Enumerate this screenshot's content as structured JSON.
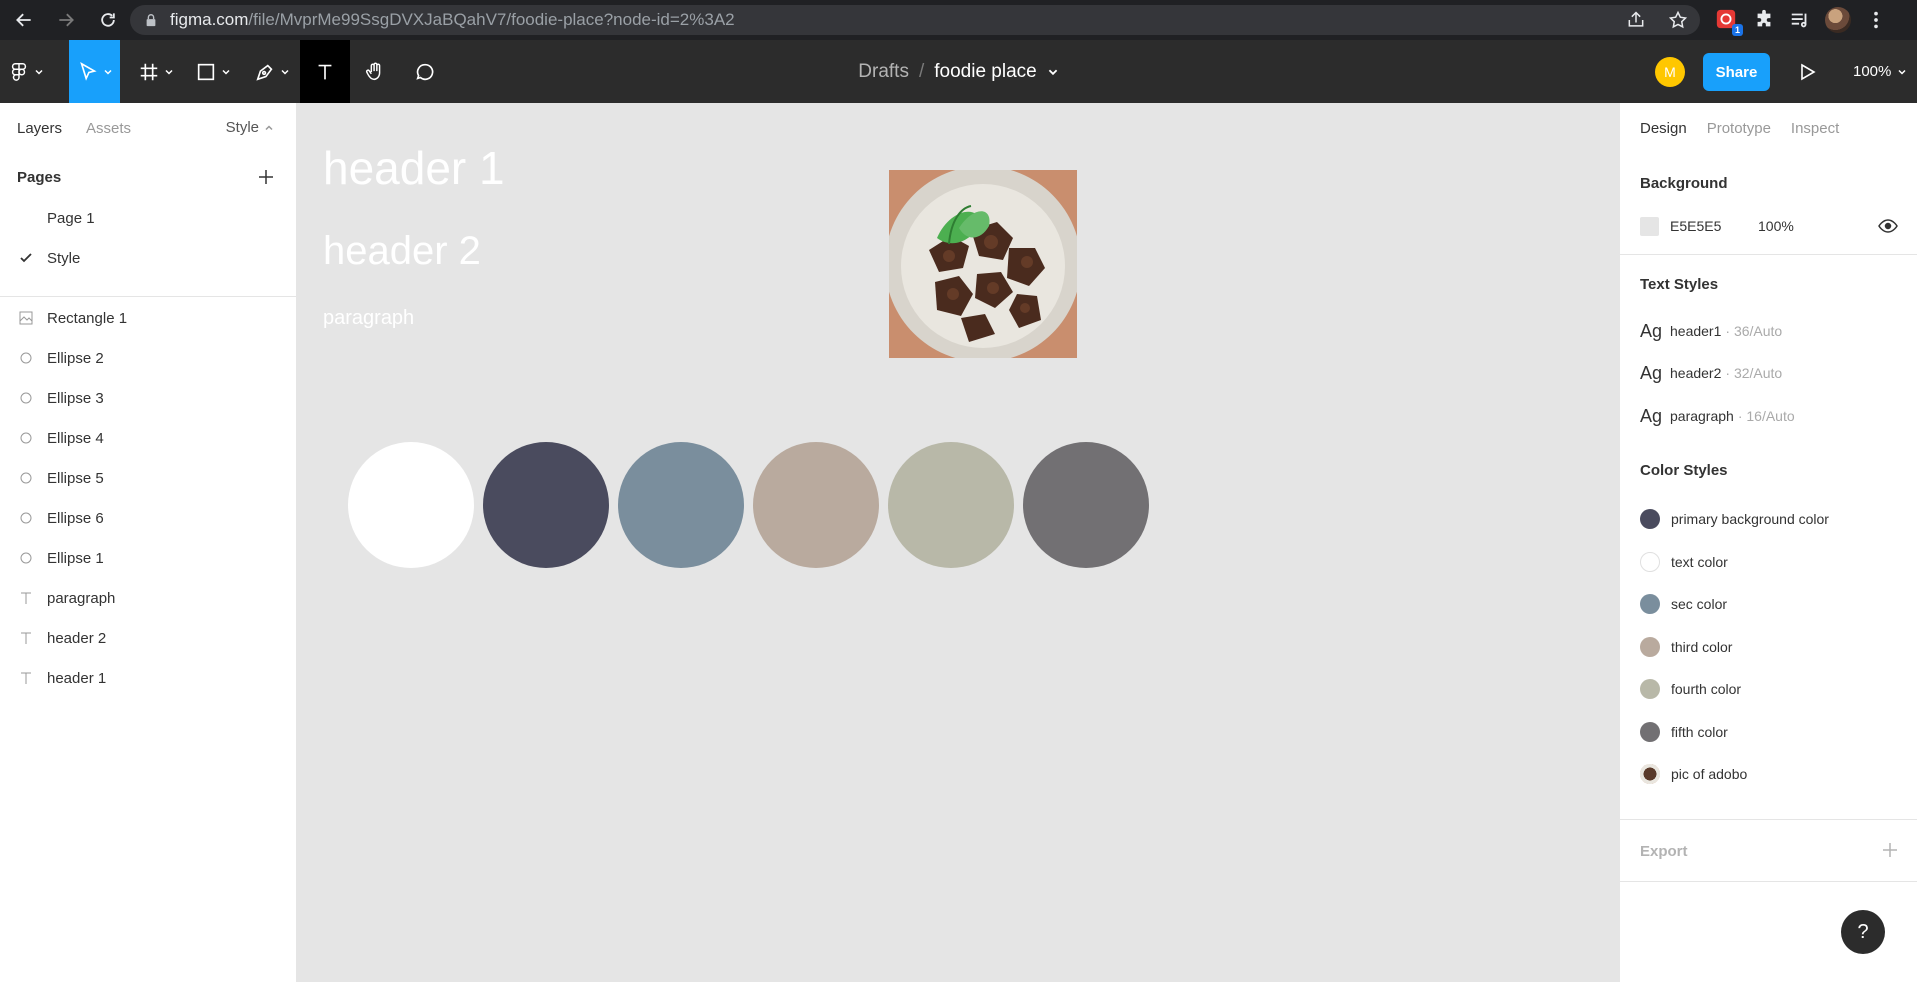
{
  "browser": {
    "url_host": "figma.com",
    "url_path": "/file/MvprMe99SsgDVXJaBQahV7/foodie-place?node-id=2%3A2",
    "ext_badge": "1"
  },
  "toolbar": {
    "breadcrumb_drafts": "Drafts",
    "breadcrumb_sep": "/",
    "file_name": "foodie place",
    "user_initial": "M",
    "share_label": "Share",
    "zoom": "100%"
  },
  "left_panel": {
    "tabs": [
      "Layers",
      "Assets"
    ],
    "style_label": "Style",
    "pages_title": "Pages",
    "pages": [
      {
        "label": "Page 1",
        "selected": false
      },
      {
        "label": "Style",
        "selected": true
      }
    ],
    "layers": [
      {
        "label": "Rectangle 1",
        "icon": "image-icon"
      },
      {
        "label": "Ellipse 2",
        "icon": "ellipse-icon"
      },
      {
        "label": "Ellipse 3",
        "icon": "ellipse-icon"
      },
      {
        "label": "Ellipse 4",
        "icon": "ellipse-icon"
      },
      {
        "label": "Ellipse 5",
        "icon": "ellipse-icon"
      },
      {
        "label": "Ellipse 6",
        "icon": "ellipse-icon"
      },
      {
        "label": "Ellipse 1",
        "icon": "ellipse-icon"
      },
      {
        "label": "paragraph",
        "icon": "text-icon"
      },
      {
        "label": "header 2",
        "icon": "text-icon"
      },
      {
        "label": "header 1",
        "icon": "text-icon"
      }
    ]
  },
  "canvas": {
    "header1": "header 1",
    "header2": "header 2",
    "paragraph": "paragraph",
    "swatches": [
      "#ffffff",
      "#4a4b5e",
      "#7a8e9d",
      "#b9aa9e",
      "#b8b8a8",
      "#727073"
    ]
  },
  "right_panel": {
    "tabs": [
      "Design",
      "Prototype",
      "Inspect"
    ],
    "background_title": "Background",
    "background_hex": "E5E5E5",
    "background_opacity": "100%",
    "text_styles_title": "Text Styles",
    "text_styles": [
      {
        "ag": "Ag",
        "name": "header1",
        "meta": "· 36/Auto"
      },
      {
        "ag": "Ag",
        "name": "header2",
        "meta": "· 32/Auto"
      },
      {
        "ag": "Ag",
        "name": "paragraph",
        "meta": "· 16/Auto"
      }
    ],
    "color_styles_title": "Color Styles",
    "color_styles": [
      {
        "name": "primary background color",
        "color": "#4a4b5e"
      },
      {
        "name": "text color",
        "color": "#ffffff"
      },
      {
        "name": "sec color",
        "color": "#7a8e9d"
      },
      {
        "name": "third color",
        "color": "#b9aa9e"
      },
      {
        "name": "fourth color",
        "color": "#b8b8a8"
      },
      {
        "name": "fifth color",
        "color": "#727073"
      },
      {
        "name": "pic of adobo",
        "color": "image"
      }
    ],
    "export_title": "Export",
    "help_label": "?"
  }
}
